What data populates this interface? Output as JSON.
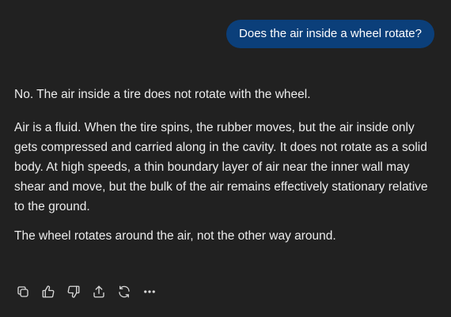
{
  "user_message": {
    "text": "Does the air inside a wheel rotate?"
  },
  "assistant_message": {
    "paragraphs": [
      "No. The air inside a tire does not rotate with the wheel.",
      "Air is a fluid. When the tire spins, the rubber moves, but the air inside only gets compressed and carried along in the cavity. It does not rotate as a solid body. At high speeds, a thin boundary layer of air near the inner wall may shear and move, but the bulk of the air remains effectively stationary relative to the ground.",
      "The wheel rotates around the air, not the other way around."
    ]
  },
  "actions": [
    {
      "icon": "copy-icon"
    },
    {
      "icon": "thumbs-up-icon"
    },
    {
      "icon": "thumbs-down-icon"
    },
    {
      "icon": "share-icon"
    },
    {
      "icon": "regenerate-icon"
    },
    {
      "icon": "more-icon"
    }
  ],
  "colors": {
    "background": "#212121",
    "user_bubble": "#0b3f7a",
    "text": "#ececec"
  }
}
